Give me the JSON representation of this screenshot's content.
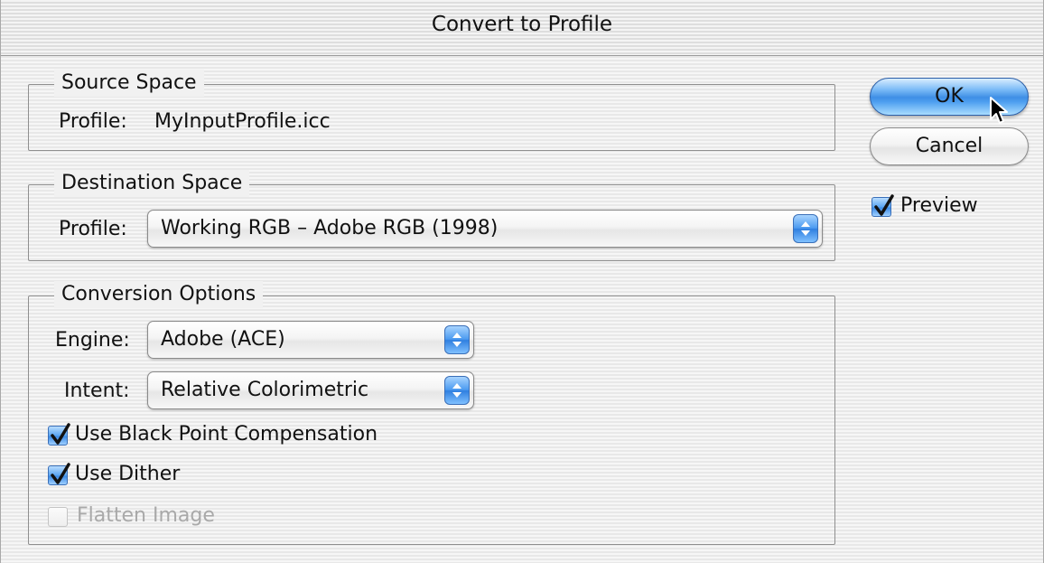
{
  "window": {
    "title": "Convert to Profile"
  },
  "source_space": {
    "group_label": "Source Space",
    "profile_label": "Profile:",
    "profile_value": "MyInputProfile.icc"
  },
  "destination_space": {
    "group_label": "Destination Space",
    "profile_label": "Profile:",
    "profile_value": "Working RGB – Adobe RGB (1998)"
  },
  "conversion_options": {
    "group_label": "Conversion Options",
    "engine_label": "Engine:",
    "engine_value": "Adobe (ACE)",
    "intent_label": "Intent:",
    "intent_value": "Relative Colorimetric",
    "black_point_label": "Use Black Point Compensation",
    "black_point_checked": true,
    "dither_label": "Use Dither",
    "dither_checked": true,
    "flatten_label": "Flatten Image",
    "flatten_checked": false,
    "flatten_enabled": false
  },
  "buttons": {
    "ok_label": "OK",
    "cancel_label": "Cancel"
  },
  "preview": {
    "label": "Preview",
    "checked": true
  },
  "icons": {
    "popup_arrows": "up-down-arrows-icon",
    "checkmark": "checkmark-icon",
    "cursor": "arrow-cursor-icon"
  },
  "colors": {
    "aqua_blue": "#3f8fe6",
    "disabled_text": "#a9a9a9"
  }
}
